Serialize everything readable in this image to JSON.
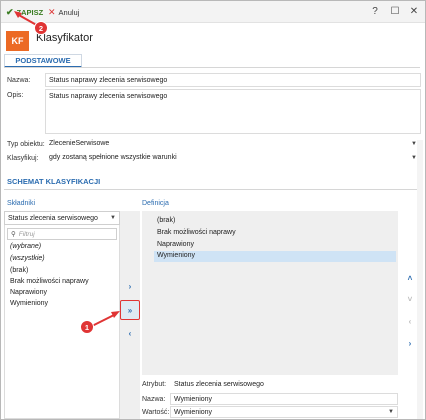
{
  "toolbar": {
    "save_label": "ZAPISZ",
    "cancel_label": "Anuluj",
    "help_label": "?",
    "maximize_label": "☐",
    "close_label": "✕"
  },
  "header": {
    "logo_text": "KF",
    "title": "Klasyfikator"
  },
  "basic": {
    "tab_label": "PODSTAWOWE",
    "name_label": "Nazwa:",
    "name_value": "Status naprawy zlecenia serwisowego",
    "desc_label": "Opis:",
    "desc_value": "Status naprawy zlecenia serwisowego",
    "type_label": "Typ obiektu:",
    "type_value": "ZlecenieSerwisowe",
    "classify_label": "Klasyfikuj:",
    "classify_value": "gdy zostaną spełnione wszystkie warunki"
  },
  "schema": {
    "title": "SCHEMAT KLASYFIKACJI",
    "components_label": "Składniki",
    "definition_label": "Definicja",
    "component_select": "Status zlecenia serwisowego",
    "filter_placeholder": "Filtruj",
    "components": [
      "(wybrane)",
      "(wszystkie)",
      "(brak)",
      "Brak możliwości naprawy",
      "Naprawiony",
      "Wymieniony"
    ],
    "definition": [
      "(brak)",
      "Brak możliwości naprawy",
      "Naprawiony",
      "Wymieniony"
    ],
    "selected_definition": "Wymieniony"
  },
  "attributes": {
    "attr_label": "Atrybut:",
    "attr_value": "Status zlecenia serwisowego",
    "name_label": "Nazwa:",
    "name_value": "Wymieniony",
    "value_label": "Wartość:",
    "value_value": "Wymieniony"
  },
  "annotations": {
    "step1": "1",
    "step2": "2"
  },
  "colors": {
    "accent": "#2b6cb0",
    "save_green": "#3a7d22",
    "logo_orange": "#ec6a24",
    "annotation_red": "#e03434",
    "selection": "#cfe3f5"
  }
}
